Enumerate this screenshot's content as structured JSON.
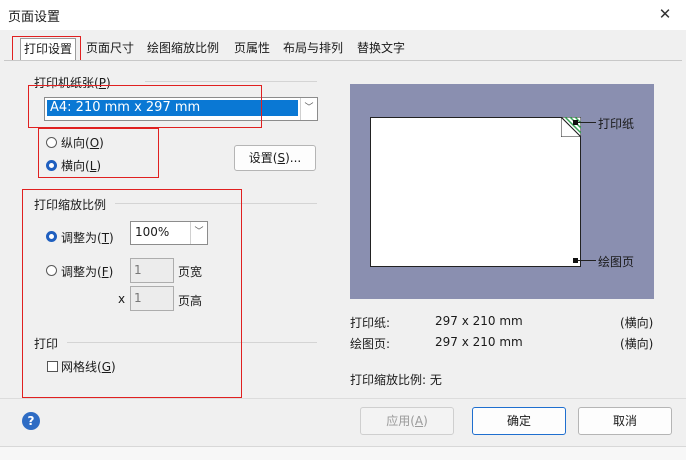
{
  "window": {
    "title": "页面设置",
    "close_glyph": "✕"
  },
  "tabs": [
    {
      "label": "打印设置",
      "active": true
    },
    {
      "label": "页面尺寸",
      "active": false
    },
    {
      "label": "绘图缩放比例",
      "active": false
    },
    {
      "label": "页属性",
      "active": false
    },
    {
      "label": "布局与排列",
      "active": false
    },
    {
      "label": "替换文字",
      "active": false
    }
  ],
  "print_paper": {
    "section_label": "打印机纸张",
    "section_key": "P",
    "paper_size": "A4:  210 mm x 297 mm",
    "orientation": {
      "portrait_label": "纵向",
      "portrait_key": "O",
      "landscape_label": "横向",
      "landscape_key": "L",
      "selected": "landscape"
    },
    "setup_button": {
      "label": "设置",
      "key": "S",
      "suffix": "..."
    }
  },
  "print_scale": {
    "section_label": "打印缩放比例",
    "adjust_to": {
      "label": "调整为",
      "key": "T",
      "value": "100%",
      "selected": true
    },
    "fit_to": {
      "label": "调整为",
      "key": "F",
      "selected": false,
      "pages_wide": "1",
      "pages_wide_unit": "页宽",
      "times": "x",
      "pages_high": "1",
      "pages_high_unit": "页高"
    }
  },
  "print": {
    "section_label": "打印",
    "gridlines": {
      "label": "网格线",
      "key": "G",
      "checked": false
    }
  },
  "preview": {
    "paper_label": "打印纸",
    "drawing_label": "绘图页"
  },
  "info": {
    "paper_label": "打印纸:",
    "paper_value": "297 x 210 mm",
    "paper_orientation": "(横向)",
    "drawing_label": "绘图页:",
    "drawing_value": "297 x 210 mm",
    "drawing_orientation": "(横向)",
    "scale_label": "打印缩放比例: 无"
  },
  "buttons": {
    "apply": {
      "label": "应用",
      "key": "A"
    },
    "ok": "确定",
    "cancel": "取消",
    "help_glyph": "?"
  },
  "colors": {
    "accent": "#0a78d4",
    "highlight_box": "#e02020",
    "preview_bg": "#8a8fb0"
  }
}
